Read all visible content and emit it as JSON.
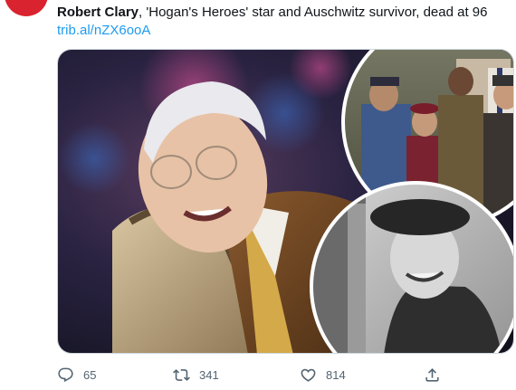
{
  "tweet": {
    "headline_bold": "Robert Clary",
    "headline_rest": ", 'Hogan's Heroes' star and Auschwitz survivor, dead at 96",
    "link": "trib.al/nZX6ooA"
  },
  "media": {
    "left_photo": "older-man-smiling-in-chair",
    "right_top_photo": "tv-cast-in-uniforms",
    "right_bottom_photo": "black-and-white-portrait-in-beret"
  },
  "actions": {
    "reply_icon": "reply-icon",
    "reply_count": "65",
    "retweet_icon": "retweet-icon",
    "retweet_count": "341",
    "like_icon": "heart-icon",
    "like_count": "814",
    "share_icon": "share-icon"
  },
  "colors": {
    "link": "#1d9bf0",
    "muted": "#536471",
    "avatar": "#d9232e"
  }
}
